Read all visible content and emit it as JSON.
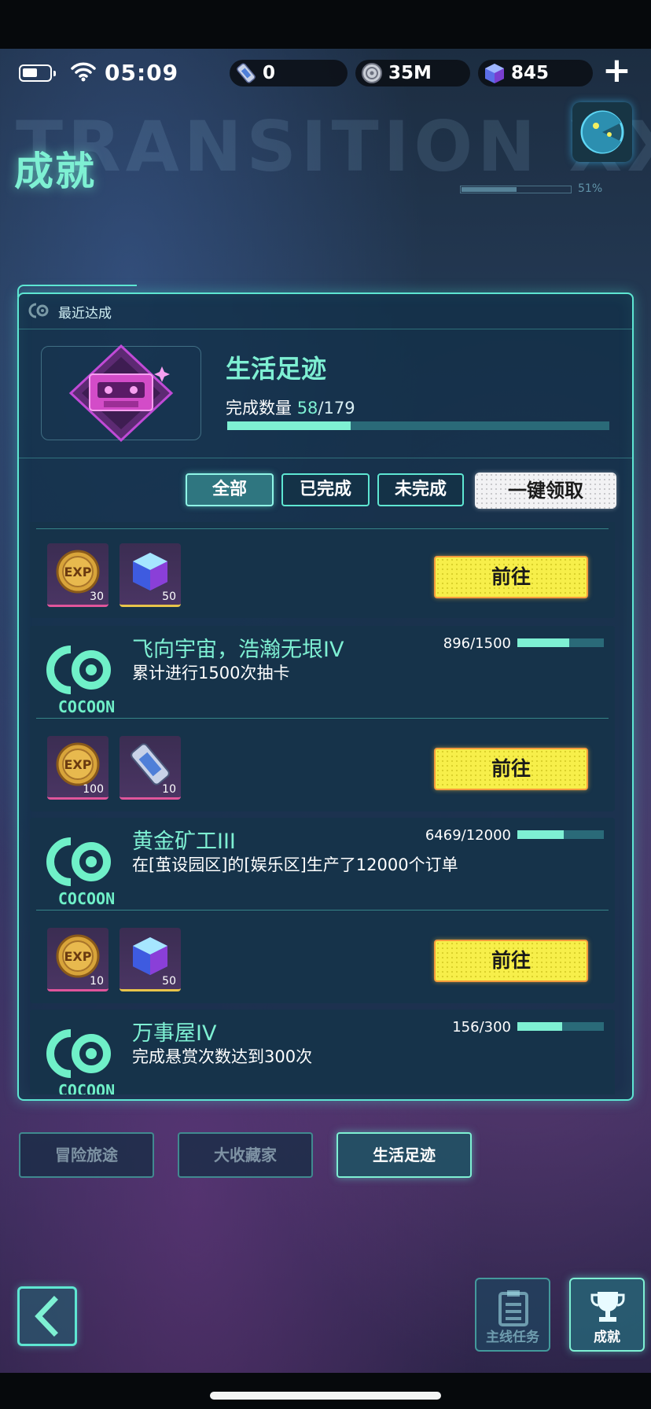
{
  "status_bar": {
    "time": "05:09"
  },
  "resources": [
    {
      "icon": "ticket-icon",
      "value": "0"
    },
    {
      "icon": "coin-icon",
      "value": "35M"
    },
    {
      "icon": "cube-gem-icon",
      "value": "845"
    }
  ],
  "page_title": "成就",
  "header_deco_pct": "51%",
  "recent": {
    "label": "最近达成",
    "category_title": "生活足迹",
    "count_label": "完成数量",
    "done": "58",
    "total": "/179",
    "progress_fraction": 0.324
  },
  "filters": {
    "all": "全部",
    "done": "已完成",
    "undone": "未完成",
    "claim_all": "一键领取"
  },
  "achievements": [
    {
      "rewards": [
        {
          "type": "exp-coin-icon",
          "qty": "30"
        },
        {
          "type": "cube-gem-icon",
          "qty": "50"
        }
      ],
      "action": "前往"
    },
    {
      "title": "飞向宇宙，浩瀚无垠IV",
      "desc": "累计进行1500次抽卡",
      "progress_text": "896/1500",
      "progress_fraction": 0.597,
      "rewards": [
        {
          "type": "exp-coin-icon",
          "qty": "100"
        },
        {
          "type": "ticket-icon",
          "qty": "10"
        }
      ],
      "action": "前往"
    },
    {
      "title": "黄金矿工III",
      "desc": "在[茧设园区]的[娱乐区]生产了12000个订单",
      "progress_text": "6469/12000",
      "progress_fraction": 0.539,
      "rewards": [
        {
          "type": "exp-coin-icon",
          "qty": "10"
        },
        {
          "type": "cube-gem-icon",
          "qty": "50"
        }
      ],
      "action": "前往"
    },
    {
      "title": "万事屋IV",
      "desc": "完成悬赏次数达到300次",
      "progress_text": "156/300",
      "progress_fraction": 0.52
    }
  ],
  "cocoon_label": "COCOON",
  "category_tabs": [
    {
      "label": "冒险旅途",
      "active": false
    },
    {
      "label": "大收藏家",
      "active": false
    },
    {
      "label": "生活足迹",
      "active": true
    }
  ],
  "bottom_nav": {
    "main_quest": "主线任务",
    "achievement": "成就"
  },
  "colors": {
    "accent": "#7ef0d3",
    "border": "#5ee6d2",
    "go_button": "#f7ef4a",
    "claim_button": "#f2f2f4"
  }
}
